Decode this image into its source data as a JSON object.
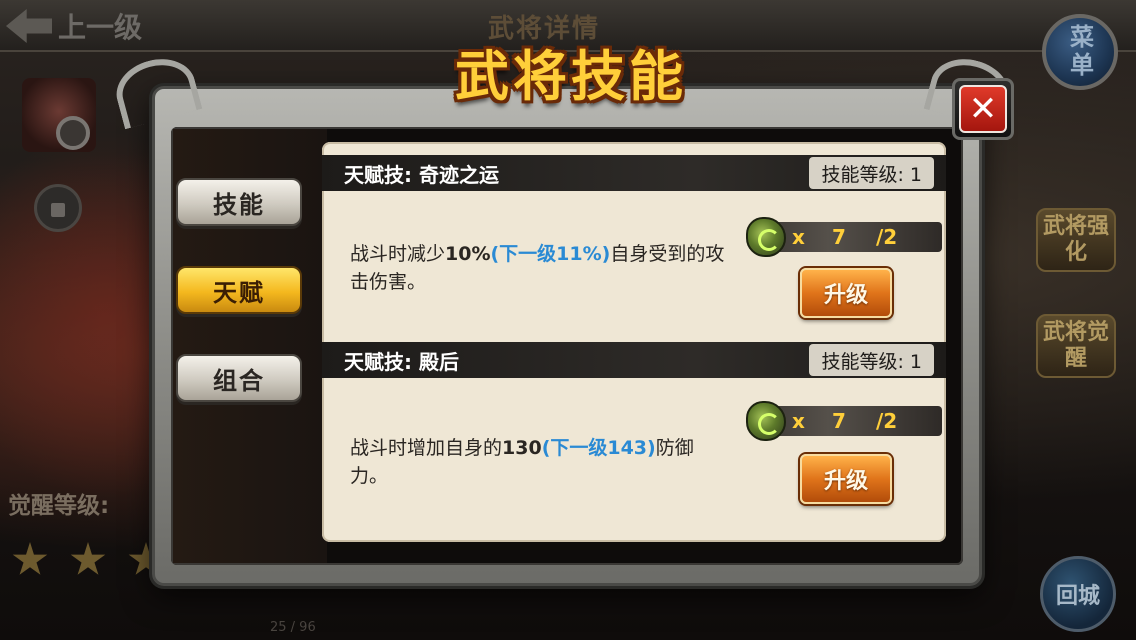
{
  "background": {
    "back_label": "上一级",
    "screen_title": "武将详情",
    "menu_label": "菜单",
    "awaken_label": "觉醒等级:",
    "side_buttons": [
      "武将强化",
      "武将觉醒"
    ],
    "return_label": "回城",
    "page_count": "25 / 96"
  },
  "dialog": {
    "title": "武将技能",
    "close_symbol": "✕",
    "tabs": [
      {
        "label": "技能",
        "active": false
      },
      {
        "label": "天赋",
        "active": true
      },
      {
        "label": "组合",
        "active": false
      }
    ]
  },
  "skills": [
    {
      "name": "天赋技: 奇迹之运",
      "level": "技能等级: 1",
      "desc_prefix": "战斗时减少",
      "desc_value": "10%",
      "desc_next": "(下一级11%)",
      "desc_suffix": "自身受到的攻击伤害。",
      "material_x": "x",
      "material_have": "7",
      "material_need": "/2",
      "upgrade_label": "升级"
    },
    {
      "name": "天赋技: 殿后",
      "level": "技能等级: 1",
      "desc_prefix": "战斗时增加自身的",
      "desc_value": "130",
      "desc_next": "(下一级143)",
      "desc_suffix": "防御力。",
      "material_x": "x",
      "material_have": "7",
      "material_need": "/2",
      "upgrade_label": "升级"
    }
  ],
  "colors": {
    "title": "#ffcf3a",
    "highlight": "#2a8ad4",
    "upgrade_button": "#e0741a",
    "active_tab": "#f4b81e"
  },
  "icons": {
    "close": "close-icon",
    "material": "green-stone-icon",
    "back": "back-arrow-icon"
  }
}
